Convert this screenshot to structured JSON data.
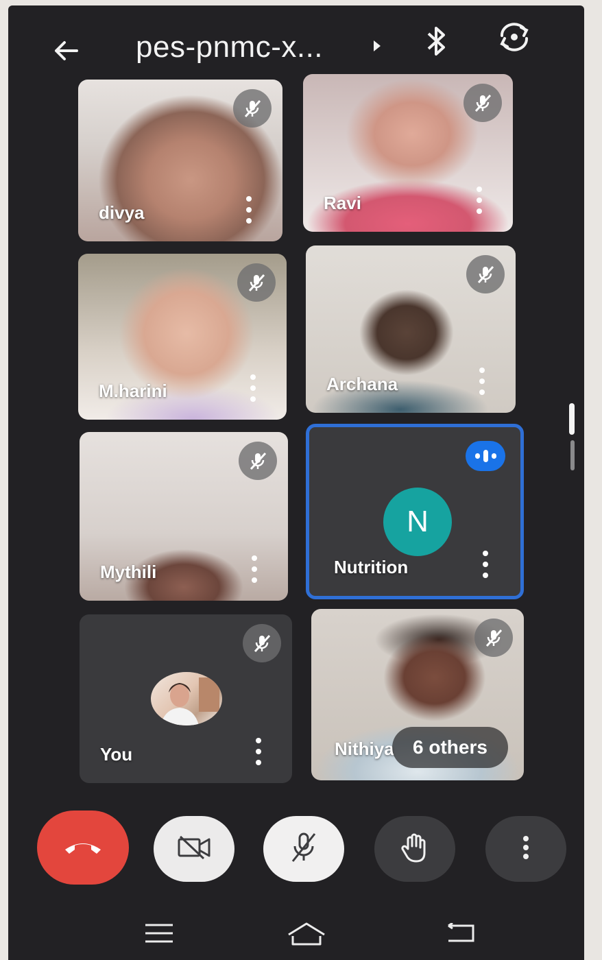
{
  "header": {
    "meeting_title": "pes-pnmc-x...",
    "icons": [
      "back-arrow-icon",
      "caret-right-icon",
      "bluetooth-icon",
      "switch-camera-icon"
    ]
  },
  "participants": [
    {
      "name": "divya",
      "muted": true
    },
    {
      "name": "Ravi",
      "muted": true
    },
    {
      "name": "M.harini",
      "muted": true
    },
    {
      "name": "Archana",
      "muted": true
    },
    {
      "name": "Mythili",
      "muted": true
    },
    {
      "name": "Nutrition",
      "avatar_letter": "N",
      "speaking": true,
      "avatar_color": "#16a3a0",
      "highlight_color": "#2f6fd6"
    },
    {
      "name": "You",
      "muted": true
    },
    {
      "name": "Nithiya",
      "muted": true
    }
  ],
  "others_chip": "6 others",
  "controls": {
    "end_call_color": "#e3463d",
    "icons": [
      "end-call-icon",
      "camera-off-icon",
      "mic-off-icon",
      "raise-hand-icon",
      "more-options-icon"
    ]
  },
  "system_nav": {
    "icons": [
      "recents-icon",
      "home-icon",
      "back-icon"
    ]
  }
}
